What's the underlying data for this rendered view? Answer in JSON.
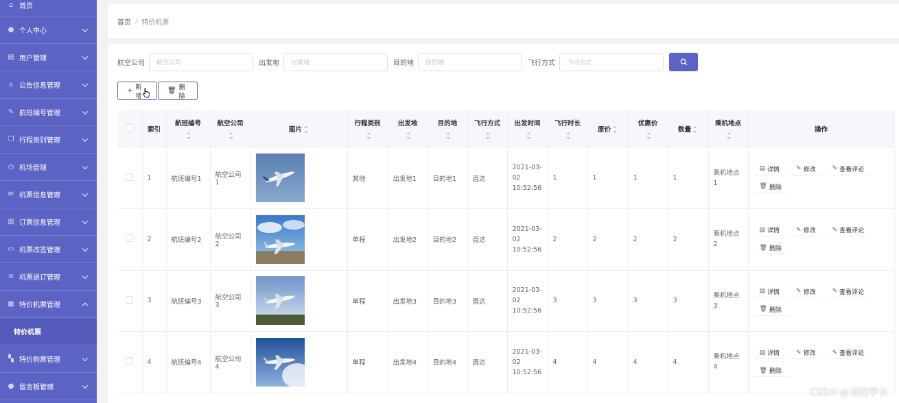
{
  "sidebar": {
    "items": [
      {
        "label": "首页",
        "icon": "home-icon",
        "glyph": "⌂"
      },
      {
        "label": "个人中心",
        "icon": "user-icon",
        "glyph": "●"
      },
      {
        "label": "用户管理",
        "icon": "clipboard-icon",
        "glyph": "▤"
      },
      {
        "label": "公告信息管理",
        "icon": "bank-icon",
        "glyph": "⌂"
      },
      {
        "label": "航班编号管理",
        "icon": "pen-icon",
        "glyph": "✎"
      },
      {
        "label": "行程类别管理",
        "icon": "copy-icon",
        "glyph": "❐"
      },
      {
        "label": "机场管理",
        "icon": "clock-icon",
        "glyph": "◷"
      },
      {
        "label": "机票信息管理",
        "icon": "mail-icon",
        "glyph": "✉"
      },
      {
        "label": "订票信息管理",
        "icon": "bar-chart-icon",
        "glyph": "▥"
      },
      {
        "label": "机票改签管理",
        "icon": "message-icon",
        "glyph": "▭"
      },
      {
        "label": "机票退订管理",
        "icon": "list-icon",
        "glyph": "≡"
      },
      {
        "label": "特价机票管理",
        "icon": "document-icon",
        "glyph": "▦"
      },
      {
        "label": "特价购票管理",
        "icon": "grid-icon",
        "glyph": "▚"
      },
      {
        "label": "留言板管理",
        "icon": "person-icon",
        "glyph": "●"
      }
    ],
    "active_sub": "特价机票"
  },
  "breadcrumb": {
    "home": "首页",
    "sep": "/",
    "current": "特价机票"
  },
  "search": {
    "airline_label": "航空公司",
    "airline_placeholder": "航空公司",
    "depart_label": "出发地",
    "depart_placeholder": "出发地",
    "dest_label": "目的地",
    "dest_placeholder": "目的地",
    "mode_label": "飞行方式",
    "mode_placeholder": "飞行方式"
  },
  "actions": {
    "add_label": "新增",
    "delete_label": "删除"
  },
  "table": {
    "headers": {
      "index": "索引",
      "flight_no": "航班编号",
      "airline": "航空公司",
      "image": "图片",
      "category": "行程类别",
      "depart": "出发地",
      "dest": "目的地",
      "mode": "飞行方式",
      "time": "出发时间",
      "duration": "飞行时长",
      "price": "原价",
      "discount": "优惠价",
      "qty": "数量",
      "boarding": "乘机地点",
      "ops": "操作"
    },
    "rows": [
      {
        "index": "1",
        "flight_no": "航班编号1",
        "airline": "航空公司1",
        "category": "其他",
        "depart": "出发地1",
        "dest": "目的地1",
        "mode": "直达",
        "time": "2021-03-02 10:52:56",
        "duration": "1",
        "price": "1",
        "discount": "1",
        "qty": "1",
        "boarding": "乘机地点1"
      },
      {
        "index": "2",
        "flight_no": "航班编号2",
        "airline": "航空公司2",
        "category": "单程",
        "depart": "出发地2",
        "dest": "目的地2",
        "mode": "直达",
        "time": "2021-03-02 10:52:56",
        "duration": "2",
        "price": "2",
        "discount": "2",
        "qty": "2",
        "boarding": "乘机地点2"
      },
      {
        "index": "3",
        "flight_no": "航班编号3",
        "airline": "航空公司3",
        "category": "单程",
        "depart": "出发地3",
        "dest": "目的地3",
        "mode": "直达",
        "time": "2021-03-02 10:52:56",
        "duration": "3",
        "price": "3",
        "discount": "3",
        "qty": "3",
        "boarding": "乘机地点3"
      },
      {
        "index": "4",
        "flight_no": "航班编号4",
        "airline": "航空公司4",
        "category": "单程",
        "depart": "出发地4",
        "dest": "目的地4",
        "mode": "直达",
        "time": "2021-03-02 10:52:56",
        "duration": "4",
        "price": "4",
        "discount": "4",
        "qty": "4",
        "boarding": "乘机地点4"
      }
    ],
    "op_labels": {
      "detail": "详情",
      "edit": "修改",
      "review": "查看评论",
      "delete": "删除"
    }
  },
  "watermark": "CSDN @涪陵学长",
  "colors": {
    "sidebar": "#5b63c4",
    "accent": "#5b63c4"
  }
}
